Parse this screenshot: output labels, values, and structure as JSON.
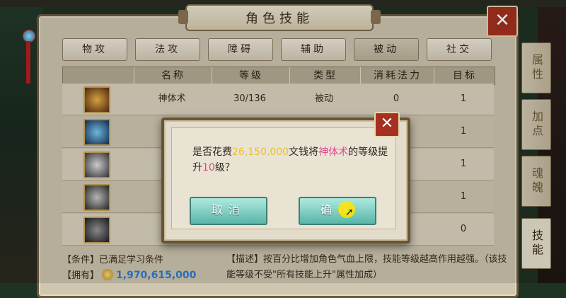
{
  "window": {
    "title": "角色技能",
    "close_label": "✕"
  },
  "tabs": [
    {
      "label": "物攻",
      "active": false
    },
    {
      "label": "法攻",
      "active": false
    },
    {
      "label": "障碍",
      "active": false
    },
    {
      "label": "辅助",
      "active": false
    },
    {
      "label": "被动",
      "active": true
    },
    {
      "label": "社交",
      "active": false
    }
  ],
  "side_tabs": [
    {
      "label": "属性",
      "active": false
    },
    {
      "label": "加点",
      "active": false
    },
    {
      "label": "魂魄",
      "active": false
    },
    {
      "label": "技能",
      "active": true
    }
  ],
  "table": {
    "headers": [
      "名称",
      "等级",
      "类型",
      "消耗法力",
      "目标"
    ],
    "rows": [
      {
        "name": "神体术",
        "level": "30/136",
        "type": "被动",
        "cost": "0",
        "target": "1",
        "icon": "golden-figure-icon"
      },
      {
        "name": "",
        "level": "",
        "type": "",
        "cost": "",
        "target": "1",
        "icon": "blue-warrior-icon"
      },
      {
        "name": "",
        "level": "",
        "type": "",
        "cost": "",
        "target": "1",
        "icon": "white-wolf-icon"
      },
      {
        "name": "",
        "level": "",
        "type": "",
        "cost": "",
        "target": "1",
        "icon": "grey-beast-icon"
      },
      {
        "name": "",
        "level": "",
        "type": "",
        "cost": "",
        "target": "0",
        "icon": "dark-rider-icon"
      }
    ]
  },
  "footer": {
    "condition_label": "【条件】",
    "condition_value": "已满足学习条件",
    "owned_label": "【拥有】",
    "owned_value": "1,970,615,000",
    "desc_label": "【描述】",
    "desc_text": "按百分比增加角色气血上限，技能等级越高作用越强。（该技能等级不受\"所有技能上升\"属性加成）"
  },
  "dialog": {
    "text_prefix": "是否花费",
    "cost": "26,150,000",
    "text_mid": "文钱将",
    "skill": "神体术",
    "text_mid2": "的等级提升",
    "level": "10",
    "text_suffix": "级？",
    "cancel_label": "取消",
    "confirm_label": "确认",
    "close_label": "✕"
  },
  "colors": {
    "accent_cost": "#e7c32b",
    "accent_skill": "#e0468e",
    "button": "#6cc2b4",
    "close": "#a6301f"
  }
}
